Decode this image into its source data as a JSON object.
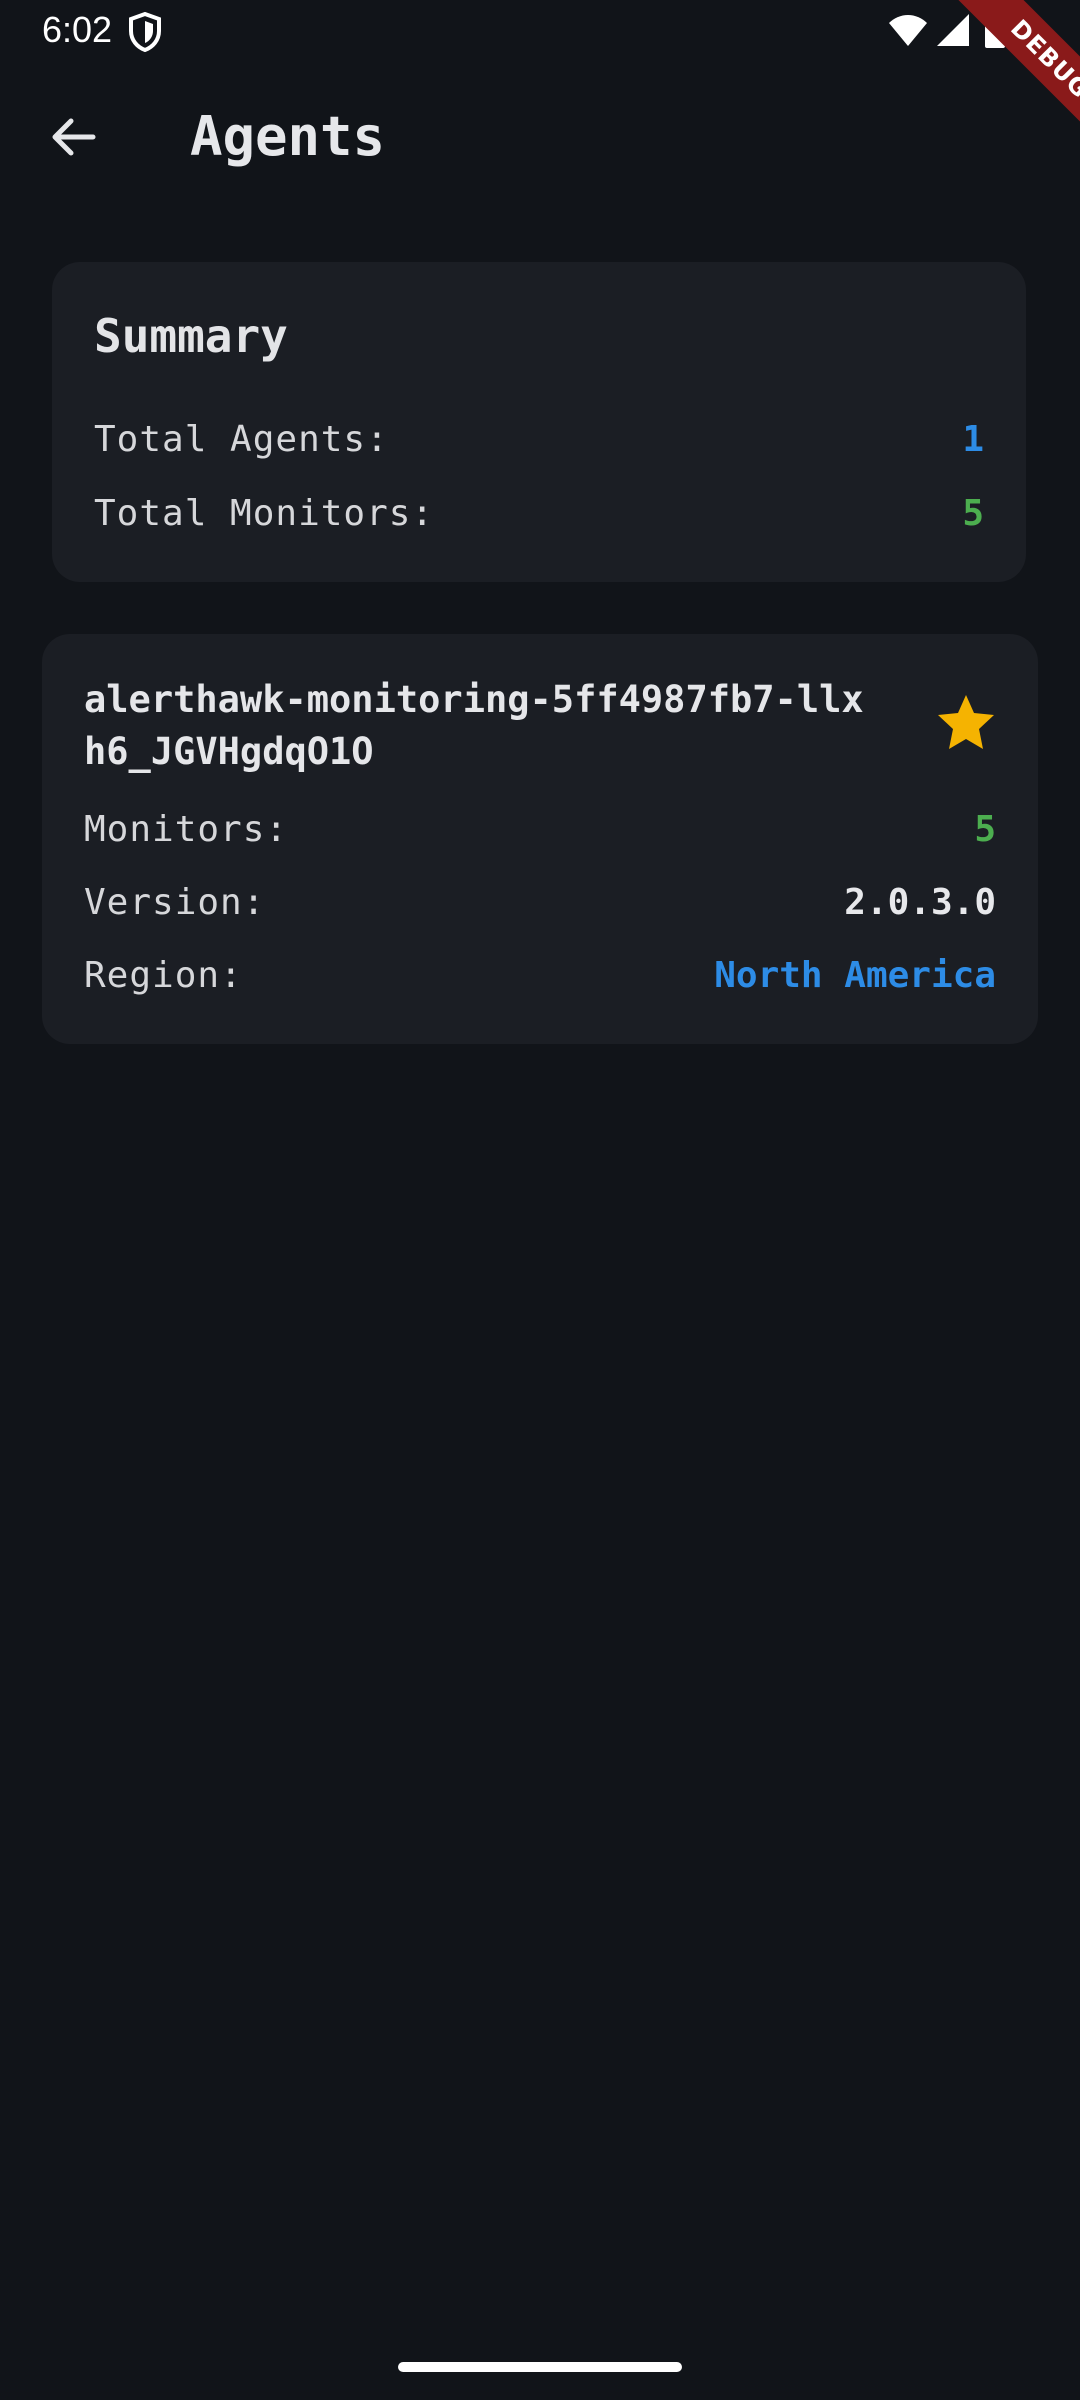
{
  "status_bar": {
    "time": "6:02",
    "icons": [
      "shield-icon",
      "wifi-icon",
      "signal-icon",
      "battery-icon"
    ]
  },
  "debug_banner": {
    "label": "DEBUG"
  },
  "app_bar": {
    "title": "Agents",
    "back_icon": "arrow-back-icon"
  },
  "summary": {
    "title": "Summary",
    "rows": [
      {
        "label": "Total Agents:",
        "value": "1",
        "color": "#2d8ce6"
      },
      {
        "label": "Total Monitors:",
        "value": "5",
        "color": "#4cae4f"
      }
    ]
  },
  "agents": [
    {
      "name": "alerthawk-monitoring-5ff4987fb7-llxh6_JGVHgdqO1O",
      "starred": true,
      "star_icon": "star-icon",
      "rows": [
        {
          "label": "Monitors:",
          "value": "5",
          "color": "#4cae4f"
        },
        {
          "label": "Version:",
          "value": "2.0.3.0",
          "color": "#e7e8eb"
        },
        {
          "label": "Region:",
          "value": "North America",
          "color": "#2d8ce6"
        }
      ]
    }
  ],
  "colors": {
    "background": "#111419",
    "card": "#1b1e24",
    "accent_blue": "#2d8ce6",
    "accent_green": "#4cae4f",
    "star": "#f5b301",
    "debug_ribbon": "#8a1a1a"
  }
}
